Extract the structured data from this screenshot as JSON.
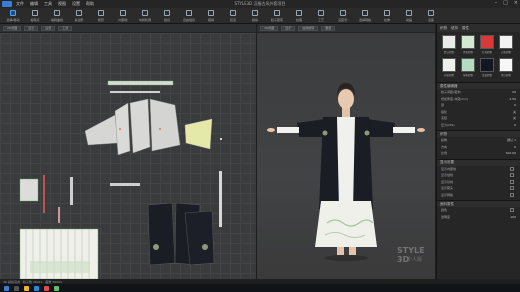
{
  "window": {
    "title": "STYLE3D 汉服古风外套项目"
  },
  "menu": [
    "文件",
    "编辑",
    "工具",
    "视图",
    "设置",
    "帮助"
  ],
  "toolbar": [
    {
      "label": "选择/移动",
      "icon": "select-icon",
      "active": true
    },
    {
      "label": "编辑点",
      "icon": "edit-point-icon"
    },
    {
      "label": "编辑曲线",
      "icon": "curve-icon"
    },
    {
      "label": "多边形",
      "icon": "polygon-icon"
    },
    {
      "label": "矩形",
      "icon": "rectangle-icon"
    },
    {
      "label": "内部线",
      "icon": "internal-line-icon"
    },
    {
      "label": "勾勒轮廓",
      "icon": "trace-icon"
    },
    {
      "label": "缝纫",
      "icon": "sew-icon"
    },
    {
      "label": "自由缝纫",
      "icon": "free-sew-icon"
    },
    {
      "label": "褶裥",
      "icon": "pleat-icon"
    },
    {
      "label": "熨烫",
      "icon": "iron-icon"
    },
    {
      "label": "模拟",
      "icon": "simulate-icon"
    },
    {
      "label": "粒子距离",
      "icon": "particle-icon"
    },
    {
      "label": "纹理",
      "icon": "texture-icon"
    },
    {
      "label": "工艺",
      "icon": "craft-icon"
    },
    {
      "label": "固定针",
      "icon": "pin-icon"
    },
    {
      "label": "选择网格",
      "icon": "mesh-icon"
    },
    {
      "label": "拉伸",
      "icon": "stretch-icon"
    },
    {
      "label": "动画",
      "icon": "animation-icon"
    },
    {
      "label": "渲染",
      "icon": "render-icon"
    }
  ],
  "panel2d": {
    "tabs": [
      "2D视图",
      "显示",
      "设置",
      "工具"
    ]
  },
  "panel3d": {
    "tabs": [
      "3D视图",
      "显示",
      "虚拟模特",
      "服装"
    ],
    "watermark": "STYLE 3D",
    "watermark_sub": "个人版"
  },
  "right_panel": {
    "tabs": [
      "织物",
      "纽扣",
      "属性"
    ],
    "swatches": [
      {
        "name": "默认织物",
        "color": "#e9ebe8"
      },
      {
        "name": "黑色织物",
        "color": "#d3e8d1"
      },
      {
        "name": "红色织物",
        "color": "#d83a3a"
      },
      {
        "name": "白色织物",
        "color": "#f3f3f3"
      },
      {
        "name": "印花织物",
        "color": "#eef1ec"
      },
      {
        "name": "绿色织物",
        "color": "#b5dcc0"
      },
      {
        "name": "深蓝织物",
        "color": "#121823"
      },
      {
        "name": "素白织物",
        "color": "#f7f7f7"
      }
    ],
    "sections": [
      {
        "title": "属性编辑器",
        "rows": [
          {
            "k": "粒子间距(毫米)",
            "v": "20"
          },
          {
            "k": "增加厚度-冲突(mm)",
            "v": "2.50"
          },
          {
            "k": "层",
            "v": "0"
          },
          {
            "k": "强化",
            "v": "关"
          },
          {
            "k": "冻结",
            "v": "关"
          },
          {
            "k": "压力(kPa)",
            "v": "0"
          }
        ]
      },
      {
        "title": "织物",
        "rows": [
          {
            "k": "织物",
            "v": "默认 1"
          },
          {
            "k": "方向",
            "v": "0"
          },
          {
            "k": "比例",
            "v": "100.00"
          }
        ]
      },
      {
        "title": "显示设置",
        "rows": [
          {
            "k": "显示内部线",
            "v": ""
          },
          {
            "k": "显示缝线",
            "v": ""
          },
          {
            "k": "显示基线",
            "v": ""
          },
          {
            "k": "显示箭头",
            "v": ""
          },
          {
            "k": "显示网格",
            "v": ""
          }
        ]
      },
      {
        "title": "面料属性",
        "rows": [
          {
            "k": "颜色",
            "v": ""
          },
          {
            "k": "透明度",
            "v": "100"
          }
        ]
      }
    ]
  },
  "status": {
    "text": "3D 模拟完成 · 粒子数 28411 · 面数 56203"
  },
  "colors": {
    "accent": "#4aa3ff",
    "garment_dark": "#1a1d24",
    "garment_light": "#f2f3ef"
  }
}
